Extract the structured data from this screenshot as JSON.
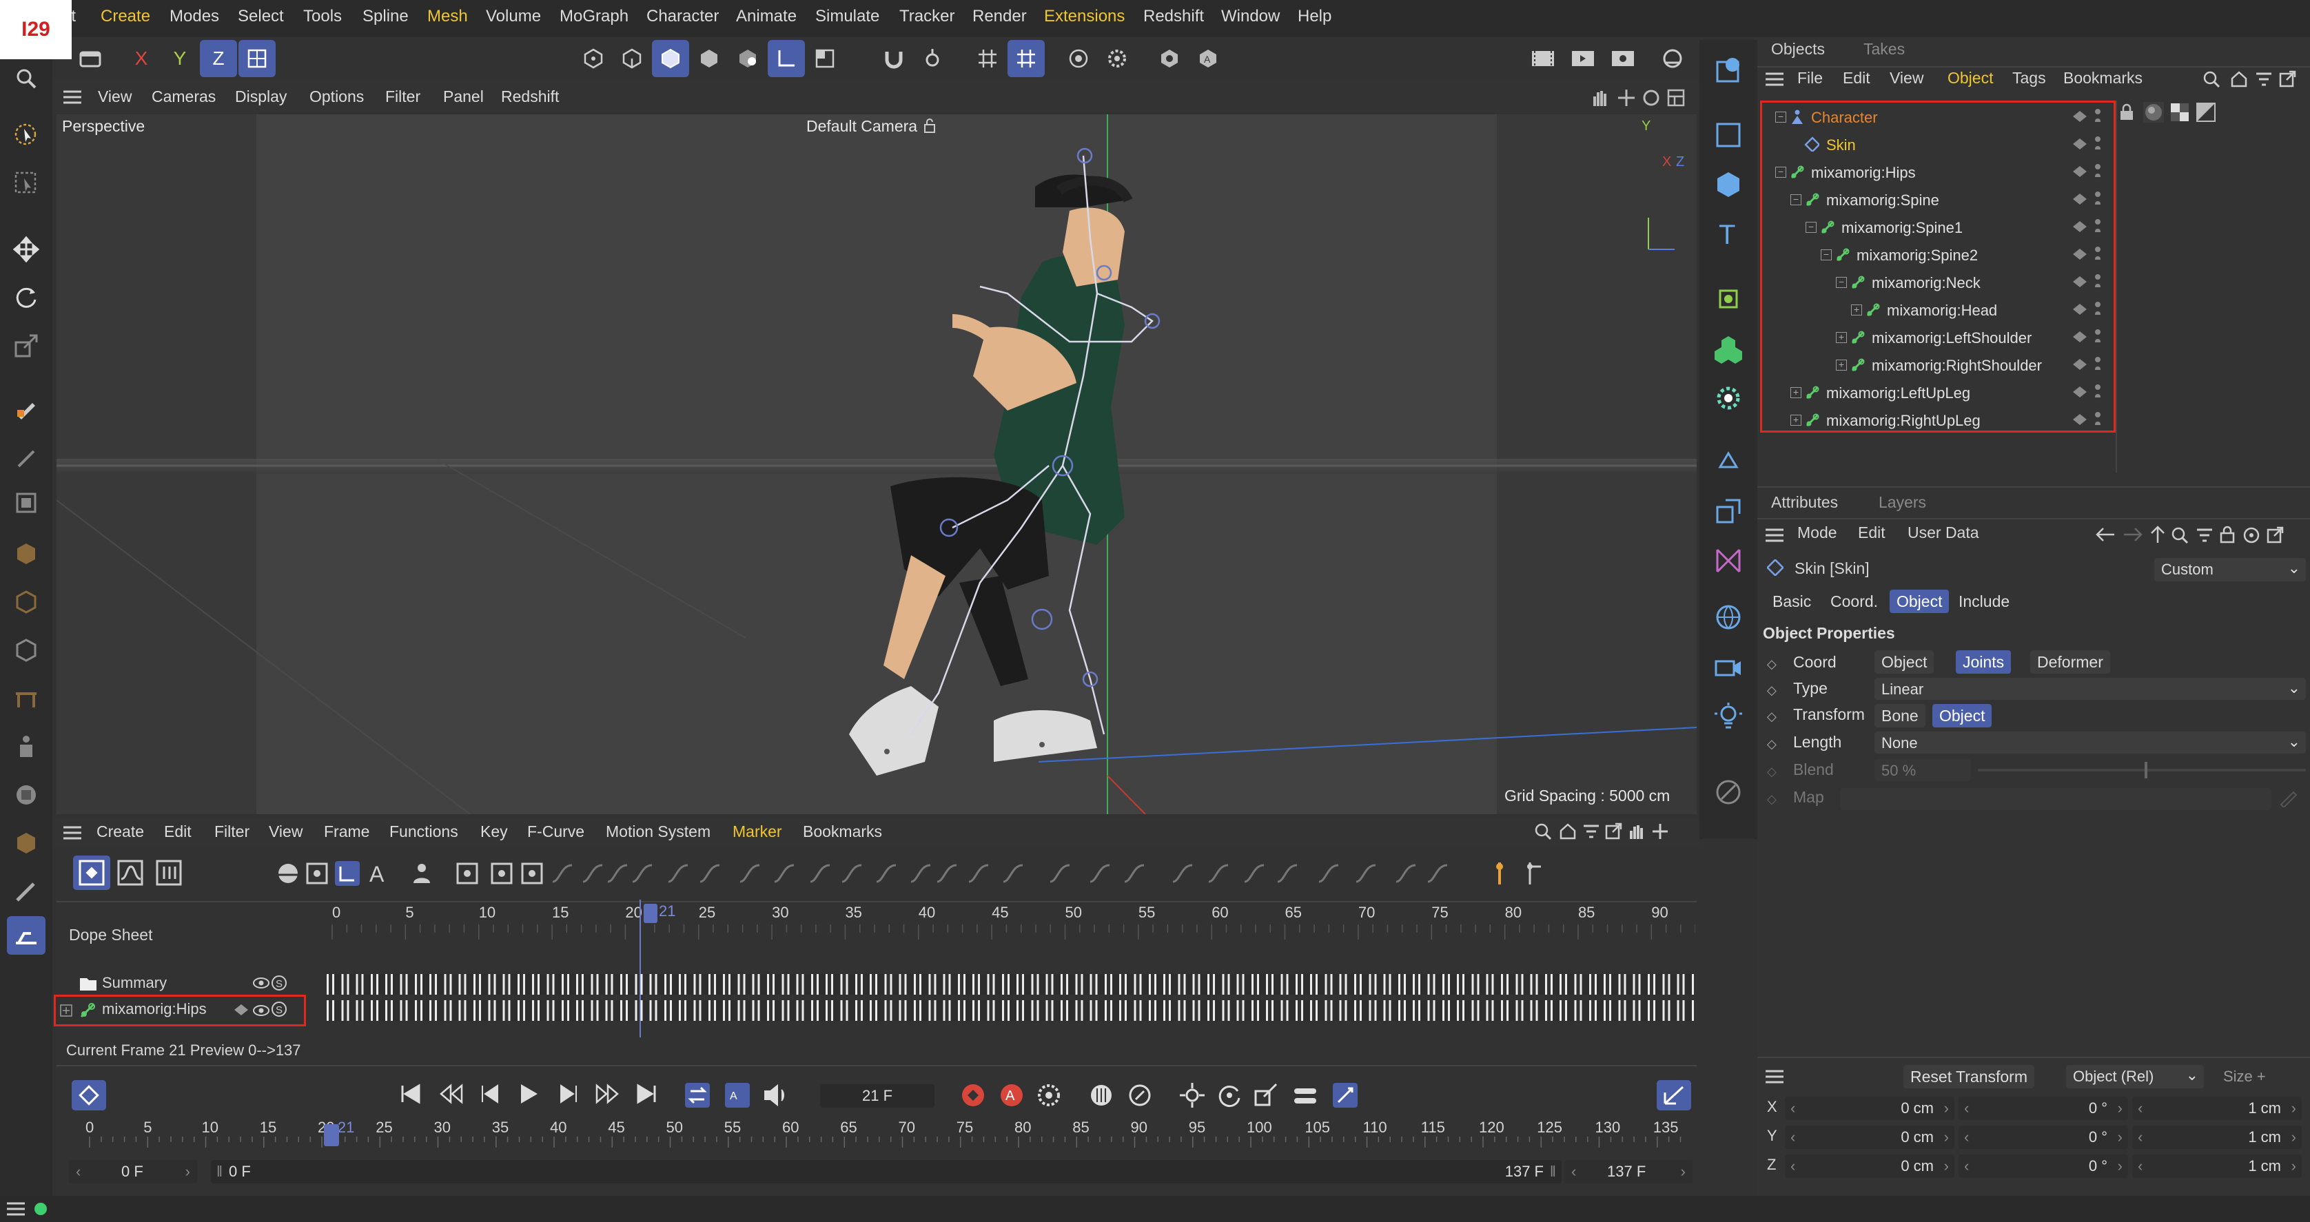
{
  "badge": "I29",
  "menu": [
    "it",
    "Create",
    "Modes",
    "Select",
    "Tools",
    "Spline",
    "Mesh",
    "Volume",
    "MoGraph",
    "Character",
    "Animate",
    "Simulate",
    "Tracker",
    "Render",
    "Extensions",
    "Redshift",
    "Window",
    "Help"
  ],
  "axis_buttons": {
    "x": "X",
    "y": "Y",
    "z": "Z"
  },
  "viewport": {
    "menu": [
      "View",
      "Cameras",
      "Display",
      "Options",
      "Filter",
      "Panel",
      "Redshift"
    ],
    "label": "Perspective",
    "camera": "Default Camera",
    "grid_spacing": "Grid Spacing : 5000 cm",
    "axis_y": "Y",
    "axis_z": "Z",
    "axis_x": "X"
  },
  "objects_panel": {
    "tabs": [
      "Objects",
      "Takes"
    ],
    "menu": [
      "File",
      "Edit",
      "View",
      "Object",
      "Tags",
      "Bookmarks"
    ],
    "items": [
      {
        "name": "Character",
        "depth": 0,
        "color": "#e8862a",
        "icon": "character-icon",
        "expander": "⊟"
      },
      {
        "name": "Skin",
        "depth": 1,
        "color": "#f0c630",
        "icon": "skin-icon",
        "expander": ""
      },
      {
        "name": "mixamorig:Hips",
        "depth": 0,
        "color": "#e0e0e0",
        "icon": "joint-icon",
        "expander": "⊟"
      },
      {
        "name": "mixamorig:Spine",
        "depth": 1,
        "color": "#e0e0e0",
        "icon": "joint-icon",
        "expander": "⊟"
      },
      {
        "name": "mixamorig:Spine1",
        "depth": 2,
        "color": "#e0e0e0",
        "icon": "joint-icon",
        "expander": "⊟"
      },
      {
        "name": "mixamorig:Spine2",
        "depth": 3,
        "color": "#e0e0e0",
        "icon": "joint-icon",
        "expander": "⊟"
      },
      {
        "name": "mixamorig:Neck",
        "depth": 4,
        "color": "#e0e0e0",
        "icon": "joint-icon",
        "expander": "⊟"
      },
      {
        "name": "mixamorig:Head",
        "depth": 5,
        "color": "#e0e0e0",
        "icon": "joint-icon",
        "expander": "⊞"
      },
      {
        "name": "mixamorig:LeftShoulder",
        "depth": 4,
        "color": "#e0e0e0",
        "icon": "joint-icon",
        "expander": "⊞"
      },
      {
        "name": "mixamorig:RightShoulder",
        "depth": 4,
        "color": "#e0e0e0",
        "icon": "joint-icon",
        "expander": "⊞"
      },
      {
        "name": "mixamorig:LeftUpLeg",
        "depth": 1,
        "color": "#e0e0e0",
        "icon": "joint-icon",
        "expander": "⊞"
      },
      {
        "name": "mixamorig:RightUpLeg",
        "depth": 1,
        "color": "#e0e0e0",
        "icon": "joint-icon",
        "expander": "⊞"
      }
    ]
  },
  "attributes": {
    "tabs": [
      "Attributes",
      "Layers"
    ],
    "menu": [
      "Mode",
      "Edit",
      "User Data"
    ],
    "object_title": "Skin [Skin]",
    "preset": "Custom",
    "subtabs": [
      "Basic",
      "Coord.",
      "Object",
      "Include"
    ],
    "active_subtab": "Object",
    "section": "Object Properties",
    "coord_label": "Coord",
    "coord_options": [
      "Object",
      "Joints",
      "Deformer"
    ],
    "coord_selected": "Joints",
    "type_label": "Type",
    "type_value": "Linear",
    "transform_label": "Transform",
    "transform_options": [
      "Bone",
      "Object"
    ],
    "transform_selected": "Object",
    "length_label": "Length",
    "length_value": "None",
    "blend_label": "Blend",
    "blend_value": "50 %",
    "blend_fraction": 0.5,
    "map_label": "Map"
  },
  "timeline": {
    "menu": [
      "Create",
      "Edit",
      "Filter",
      "View",
      "Frame",
      "Functions",
      "Key",
      "F-Curve",
      "Motion System",
      "Marker",
      "Bookmarks"
    ],
    "dope_sheet": "Dope Sheet",
    "summary": "Summary",
    "track": "mixamorig:Hips",
    "ruler_ticks": [
      "0",
      "5",
      "10",
      "15",
      "20",
      "21",
      "25",
      "30",
      "35",
      "40",
      "45",
      "50",
      "55",
      "60",
      "65",
      "70",
      "75",
      "80",
      "85",
      "90"
    ],
    "current_frame_marker": "21",
    "status": "Current Frame  21  Preview  0-->137"
  },
  "playback": {
    "frame_field": "21 F",
    "ruler_ticks": [
      "0",
      "5",
      "10",
      "15",
      "20",
      "21",
      "25",
      "30",
      "35",
      "40",
      "45",
      "50",
      "55",
      "60",
      "65",
      "70",
      "75",
      "80",
      "85",
      "90",
      "95",
      "100",
      "105",
      "110",
      "115",
      "120",
      "125",
      "130",
      "135"
    ],
    "start_field": "0 F",
    "start_inner": "0 F",
    "end_inner": "137 F",
    "end_field": "137 F"
  },
  "coordinates": {
    "reset_button": "Reset Transform",
    "mode": "Object (Rel)",
    "size_mode": "Size +",
    "rows": [
      {
        "axis": "X",
        "pos": "0 cm",
        "rot": "0 °",
        "size": "1 cm"
      },
      {
        "axis": "Y",
        "pos": "0 cm",
        "rot": "0 °",
        "size": "1 cm"
      },
      {
        "axis": "Z",
        "pos": "0 cm",
        "rot": "0 °",
        "size": "1 cm"
      }
    ]
  }
}
